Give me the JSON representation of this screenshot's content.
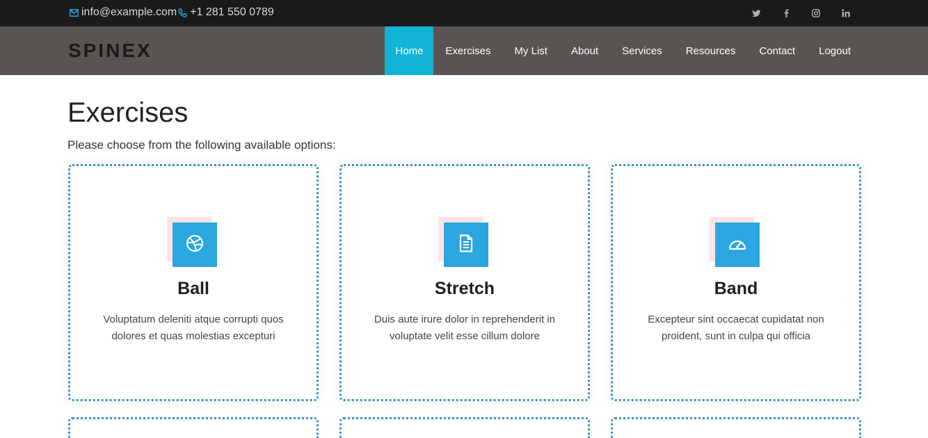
{
  "topbar": {
    "email": "info@example.com",
    "phone": "+1 281 550 0789",
    "social": [
      "twitter-icon",
      "facebook-icon",
      "instagram-icon",
      "linkedin-icon"
    ]
  },
  "brand": {
    "logo": "SPINEX"
  },
  "nav": {
    "items": [
      "Home",
      "Exercises",
      "My List",
      "About",
      "Services",
      "Resources",
      "Contact",
      "Logout"
    ],
    "active": "Home"
  },
  "main": {
    "title": "Exercises",
    "subtitle": "Please choose from the following available options:",
    "cards": [
      {
        "title": "Ball",
        "desc": "Voluptatum deleniti atque corrupti quos dolores et quas molestias excepturi",
        "icon": "dribbble-icon"
      },
      {
        "title": "Stretch",
        "desc": "Duis aute irure dolor in reprehenderit in voluptate velit esse cillum dolore",
        "icon": "document-icon"
      },
      {
        "title": "Band",
        "desc": "Excepteur sint occaecat cupidatat non proident, sunt in culpa qui officia",
        "icon": "speedometer-icon"
      }
    ]
  },
  "colors": {
    "accent": "#12b4d6",
    "icon_bg": "#2aa6e0",
    "icon_shadow": "#fde4e4",
    "card_border": "#3b90c4",
    "navbar_bg": "#595352",
    "topbar_bg": "#1a1a1a"
  }
}
